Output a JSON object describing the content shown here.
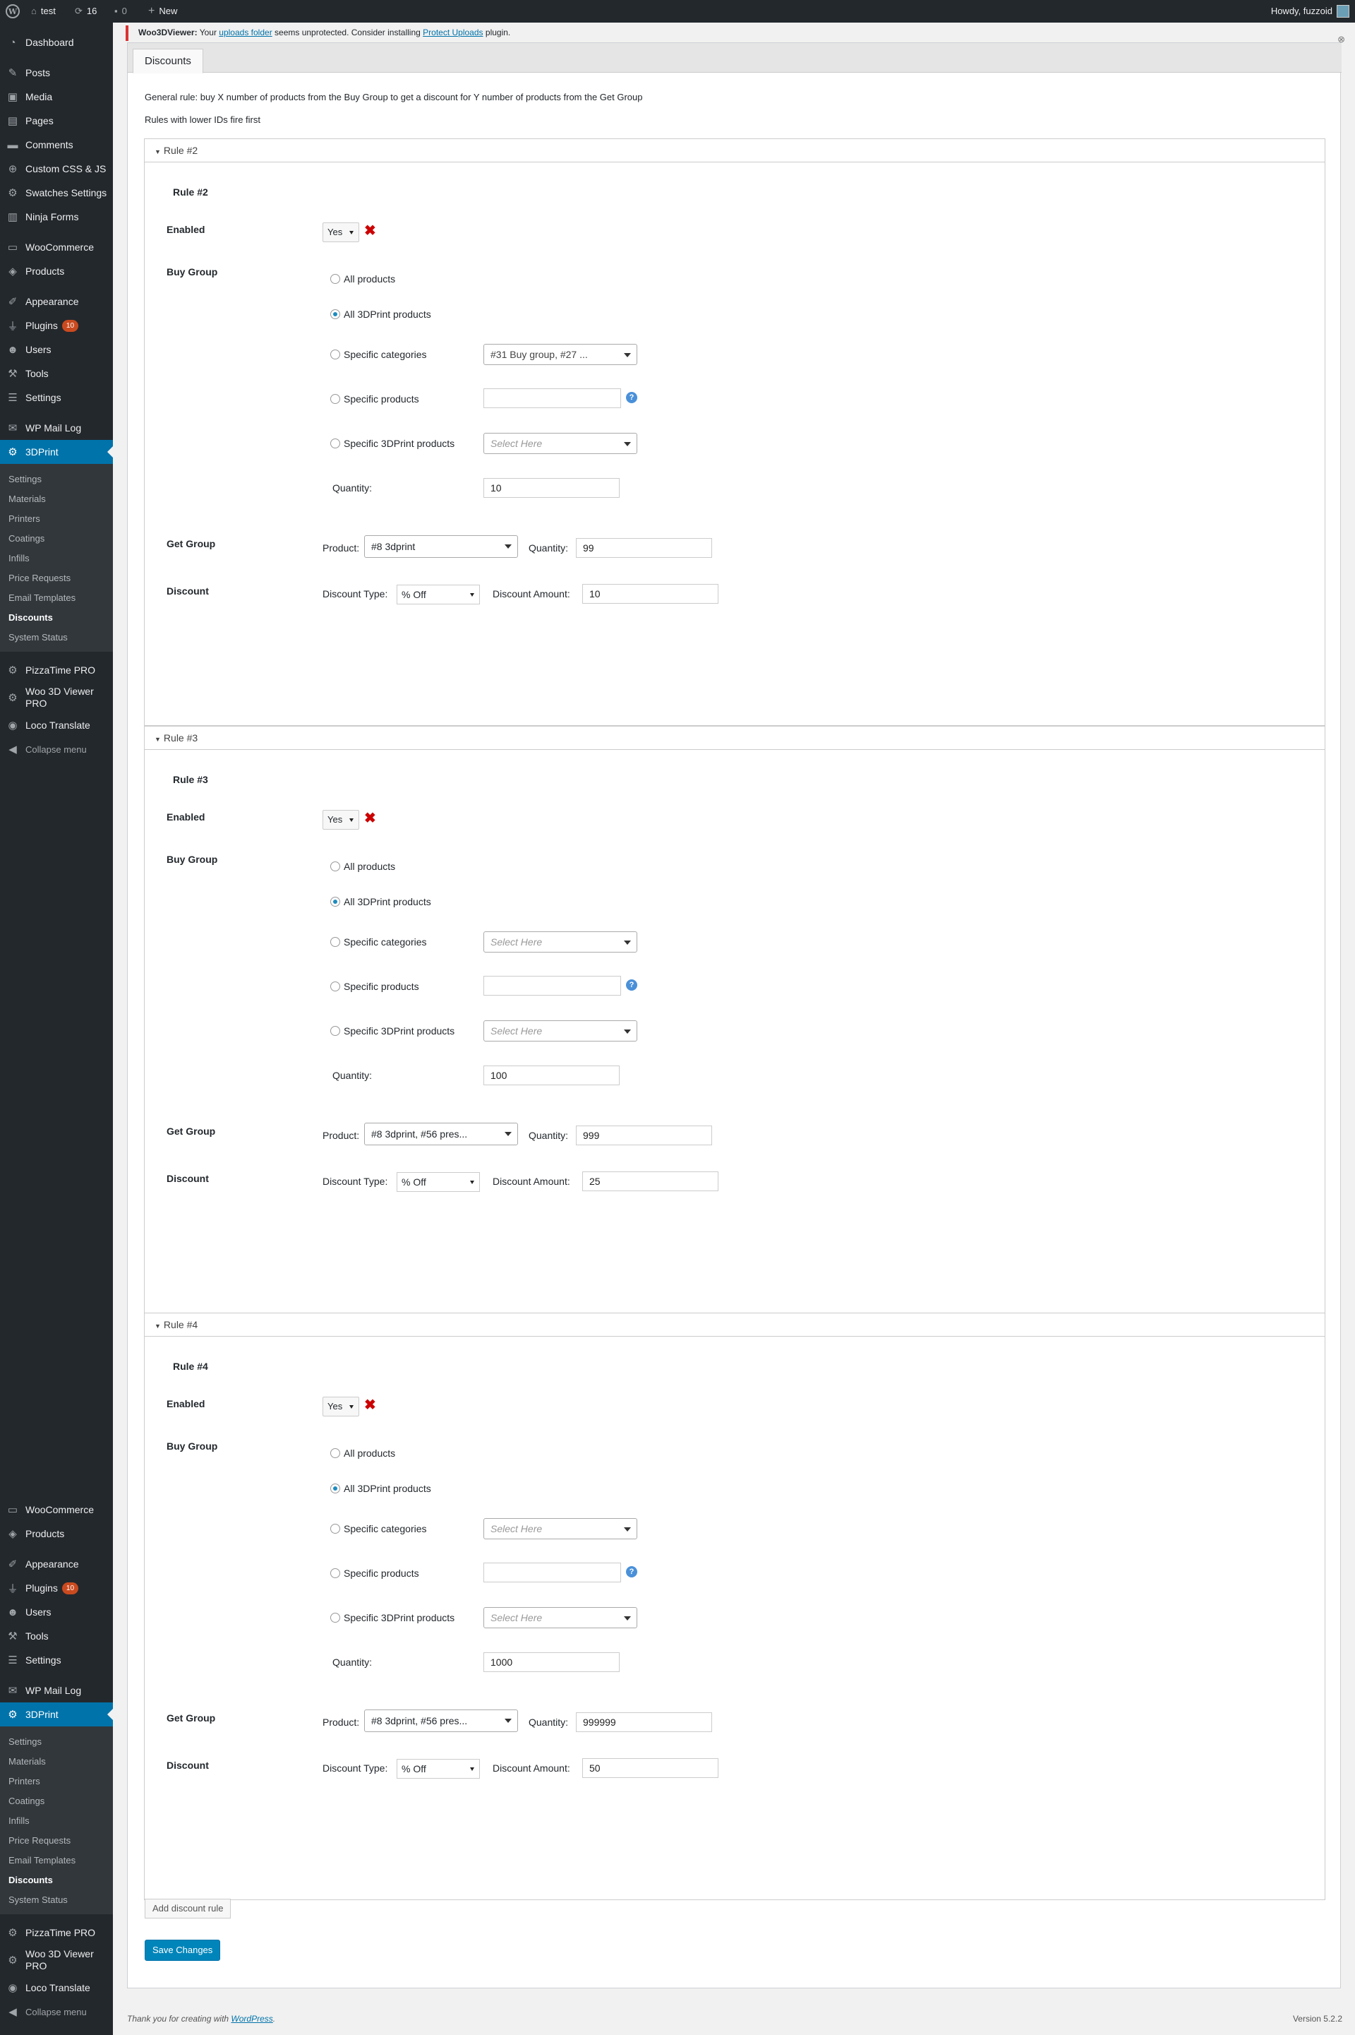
{
  "adminbar": {
    "site_name": "test",
    "updates_count": "16",
    "comments_count": "0",
    "new_label": "New",
    "howdy": "Howdy, fuzzoid"
  },
  "sidebar": {
    "items": [
      {
        "label": "Dashboard",
        "icon": "dashboard-icon"
      },
      {
        "label": "Posts",
        "icon": "pin-icon"
      },
      {
        "label": "Media",
        "icon": "media-icon"
      },
      {
        "label": "Pages",
        "icon": "page-icon"
      },
      {
        "label": "Comments",
        "icon": "comment-icon"
      },
      {
        "label": "Custom CSS & JS",
        "icon": "plus-icon"
      },
      {
        "label": "Swatches Settings",
        "icon": "gear-icon"
      },
      {
        "label": "Ninja Forms",
        "icon": "forms-icon"
      },
      {
        "label": "WooCommerce",
        "icon": "woocommerce-icon"
      },
      {
        "label": "Products",
        "icon": "box-icon"
      },
      {
        "label": "Appearance",
        "icon": "brush-icon"
      },
      {
        "label": "Plugins",
        "icon": "plug-icon",
        "badge": "10"
      },
      {
        "label": "Users",
        "icon": "user-icon"
      },
      {
        "label": "Tools",
        "icon": "wrench-icon"
      },
      {
        "label": "Settings",
        "icon": "sliders-icon"
      },
      {
        "label": "WP Mail Log",
        "icon": "mail-icon"
      },
      {
        "label": "3DPrint",
        "icon": "gear-icon"
      }
    ],
    "submenu": [
      "Settings",
      "Materials",
      "Printers",
      "Coatings",
      "Infills",
      "Price Requests",
      "Email Templates",
      "Discounts",
      "System Status"
    ],
    "after": [
      {
        "label": "PizzaTime PRO",
        "icon": "gear-icon"
      },
      {
        "label": "Woo 3D Viewer PRO",
        "icon": "gear-icon"
      },
      {
        "label": "Loco Translate",
        "icon": "translate-icon"
      }
    ],
    "collapse": "Collapse menu"
  },
  "notice": {
    "plugin": "Woo3DViewer:",
    "text1": "Your",
    "link1": "uploads folder",
    "text2": "seems unprotected. Consider installing",
    "link2": "Protect Uploads",
    "text3": "plugin."
  },
  "tab": {
    "label": "Discounts"
  },
  "intro": {
    "line1": "General rule: buy X number of products from the Buy Group to get a discount for Y number of products from the Get Group",
    "line2": "Rules with lower IDs fire first"
  },
  "labels": {
    "enabled": "Enabled",
    "buy_group": "Buy Group",
    "get_group": "Get Group",
    "discount": "Discount",
    "all_products": "All products",
    "all_3dprint": "All 3DPrint products",
    "specific_categories": "Specific categories",
    "specific_products": "Specific products",
    "specific_3dprint": "Specific 3DPrint products",
    "quantity": "Quantity:",
    "product": "Product:",
    "quantity_short": "Quantity:",
    "discount_type": "Discount Type:",
    "discount_amount": "Discount Amount:",
    "select_here": "Select Here"
  },
  "rules": [
    {
      "header": "Rule #2",
      "title": "Rule #2",
      "enabled": "Yes",
      "categories": "#31 Buy group, #27 ...",
      "buy_quantity": "10",
      "product": "#8 3dprint",
      "get_quantity": "99",
      "discount_type": "% Off",
      "discount_amount": "10"
    },
    {
      "header": "Rule #3",
      "title": "Rule #3",
      "enabled": "Yes",
      "categories": "Select Here",
      "buy_quantity": "100",
      "product": "#8 3dprint, #56 pres...",
      "get_quantity": "999",
      "discount_type": "% Off",
      "discount_amount": "25"
    },
    {
      "header": "Rule #4",
      "title": "Rule #4",
      "enabled": "Yes",
      "categories": "Select Here",
      "buy_quantity": "1000",
      "product": "#8 3dprint, #56 pres...",
      "get_quantity": "999999",
      "discount_type": "% Off",
      "discount_amount": "50"
    }
  ],
  "buttons": {
    "add_rule": "Add discount rule",
    "save": "Save Changes"
  },
  "footer": {
    "thanks": "Thank you for creating with",
    "wp_link": "WordPress",
    "version": "Version 5.2.2"
  },
  "colors": {
    "accent": "#0073aa",
    "admin_bar": "#23282d",
    "badge": "#ca4a1f",
    "delete": "#cc0000"
  }
}
